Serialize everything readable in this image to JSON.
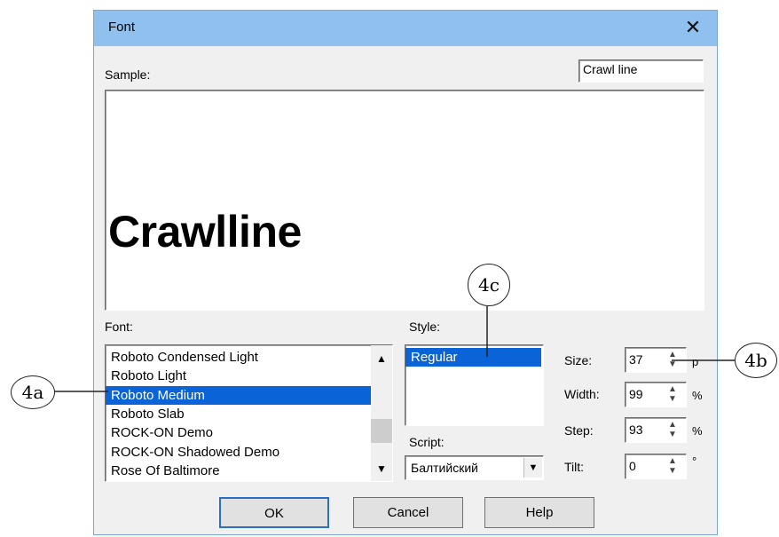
{
  "dialog": {
    "title": "Font",
    "close_icon": "close-icon"
  },
  "sample": {
    "label": "Sample:",
    "input_value": "Crawl line",
    "preview_text": "Crawlline"
  },
  "font": {
    "label": "Font:",
    "items": [
      "Roboto Condensed Light",
      "Roboto Light",
      "Roboto Medium",
      "Roboto Slab",
      "ROCK-ON Demo",
      "ROCK-ON Shadowed Demo",
      "Rose Of Baltimore"
    ],
    "selected_index": 2
  },
  "style": {
    "label": "Style:",
    "items": [
      "Regular"
    ],
    "selected_index": 0
  },
  "script": {
    "label": "Script:",
    "value": "Балтийский"
  },
  "size": {
    "label": "Size:",
    "value": "37",
    "unit": "p"
  },
  "width": {
    "label": "Width:",
    "value": "99",
    "unit": "%"
  },
  "step": {
    "label": "Step:",
    "value": "93",
    "unit": "%"
  },
  "tilt": {
    "label": "Tilt:",
    "value": "0",
    "unit": "°"
  },
  "buttons": {
    "ok": "OK",
    "cancel": "Cancel",
    "help": "Help"
  },
  "callouts": {
    "a": "4a",
    "b": "4b",
    "c": "4c"
  }
}
